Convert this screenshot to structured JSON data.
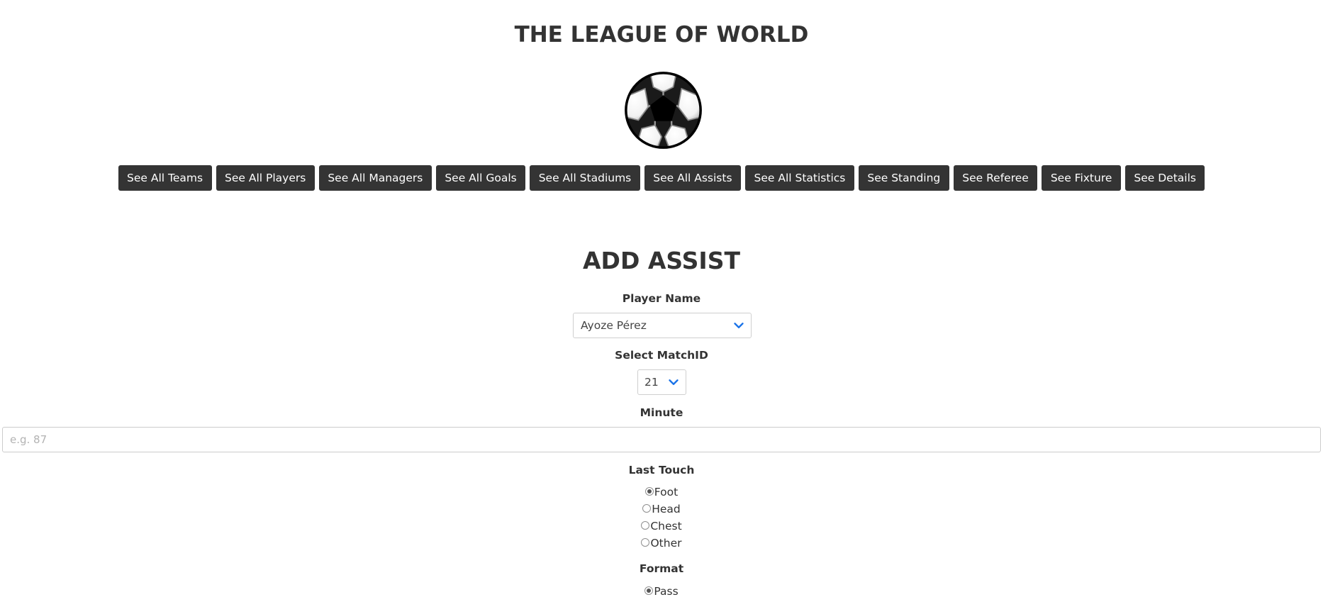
{
  "header": {
    "title": "THE LEAGUE OF WORLD"
  },
  "nav": {
    "buttons": [
      "See All Teams",
      "See All Players",
      "See All Managers",
      "See All Goals",
      "See All Stadiums",
      "See All Assists",
      "See All Statistics",
      "See Standing",
      "See Referee",
      "See Fixture",
      "See Details"
    ]
  },
  "form": {
    "title": "ADD ASSIST",
    "player": {
      "label": "Player Name",
      "selected": "Ayoze Pérez"
    },
    "match": {
      "label": "Select MatchID",
      "selected": "21"
    },
    "minute": {
      "label": "Minute",
      "value": "",
      "placeholder": "e.g. 87"
    },
    "last_touch": {
      "label": "Last Touch",
      "options": [
        "Foot",
        "Head",
        "Chest",
        "Other"
      ],
      "selected": "Foot"
    },
    "format": {
      "label": "Format",
      "options": [
        "Pass"
      ],
      "selected": "Pass"
    }
  },
  "colors": {
    "button_bg": "#343434",
    "button_text": "#ffffff",
    "chevron": "#1a73e8",
    "text": "#333333"
  },
  "icons": {
    "logo": "soccer-ball-icon",
    "dropdown": "chevron-down-icon"
  }
}
